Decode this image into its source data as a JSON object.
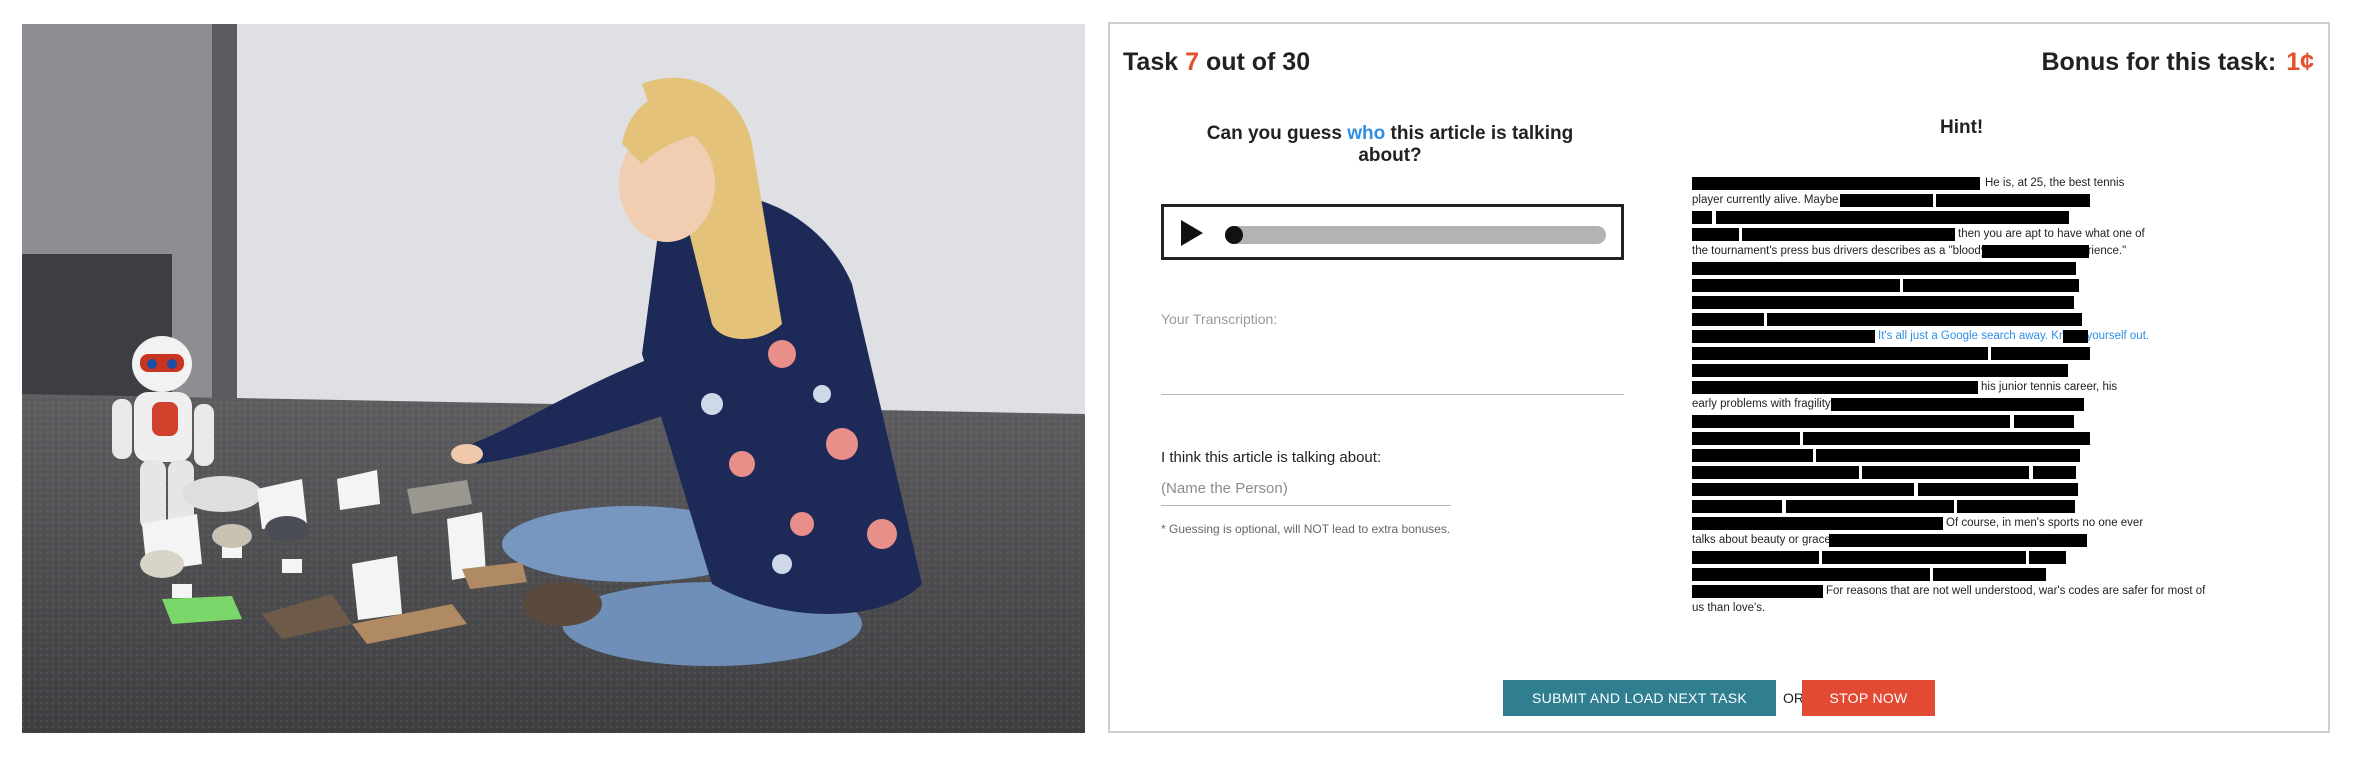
{
  "photo": {
    "description_icon": "photo-of-woman-and-robot"
  },
  "task": {
    "prefix": "Task",
    "current": "7",
    "suffix": "out of 30"
  },
  "bonus": {
    "label": "Bonus for this task:",
    "amount": "1¢"
  },
  "question": {
    "before": "Can you guess",
    "highlight": "who",
    "after": "this article is talking about?"
  },
  "audio": {
    "play_icon": "play-icon",
    "progress": 0
  },
  "transcription": {
    "label": "Your Transcription:",
    "value": ""
  },
  "guess": {
    "label": "I think this article is talking about:",
    "placeholder": "(Name the Person)",
    "note": "* Guessing is optional, will NOT lead to extra bonuses."
  },
  "hint": {
    "title": "Hint!",
    "fragments": [
      "He is, at 25, the best tennis",
      "player currently alive.  Maybe the best ever.",
      "then you are apt to have what one of",
      "the tournament's press bus drivers describes as a \"bloody near-religious experience.\"",
      "It's all just a Google search away.  Knock yourself out.",
      "his junior tennis career, his",
      "early problems with fragility and temper,",
      "Of course, in men's sports no one ever",
      "talks about beauty or grace or the body.",
      "For reasons that are not well understood, war's codes are safer for most of",
      "us than love's."
    ]
  },
  "actions": {
    "submit": "SUBMIT AND LOAD NEXT TASK",
    "or": "OR",
    "stop": "STOP NOW"
  },
  "colors": {
    "accent_orange": "#e3502b",
    "accent_blue": "#2f8fe6",
    "submit_bg": "#2f7f91",
    "stop_bg": "#e34a33"
  }
}
